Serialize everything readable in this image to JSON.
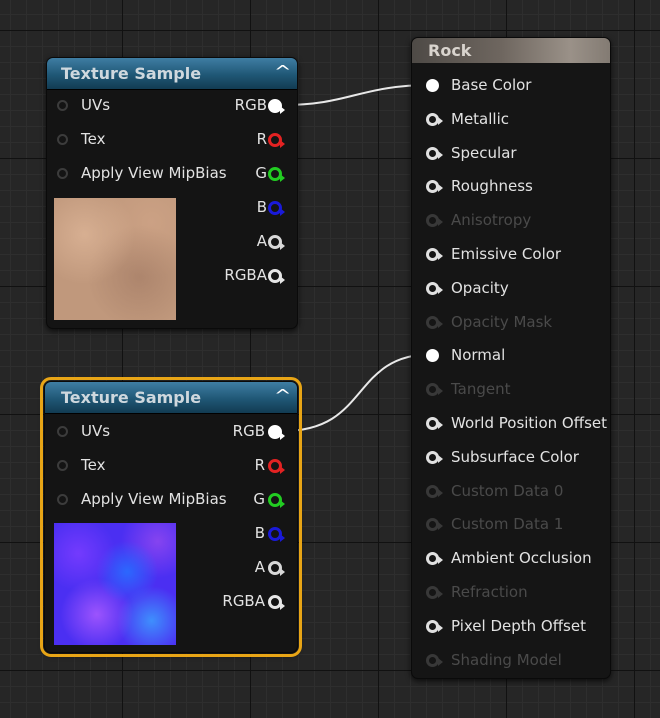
{
  "texture_nodes": [
    {
      "title": "Texture Sample",
      "inputs": [
        "UVs",
        "Tex",
        "Apply View MipBias"
      ],
      "outputs": [
        {
          "label": "RGB",
          "color": "#ffffff"
        },
        {
          "label": "R",
          "color": "#e32222"
        },
        {
          "label": "G",
          "color": "#22cc22"
        },
        {
          "label": "B",
          "color": "#1a1ad9"
        },
        {
          "label": "A",
          "color": "#d8d8d8"
        },
        {
          "label": "RGBA",
          "color": "#e6e6e6"
        }
      ],
      "thumbnail": "diffuse-rock-texture",
      "selected": false
    },
    {
      "title": "Texture Sample",
      "inputs": [
        "UVs",
        "Tex",
        "Apply View MipBias"
      ],
      "outputs": [
        {
          "label": "RGB",
          "color": "#ffffff"
        },
        {
          "label": "R",
          "color": "#e32222"
        },
        {
          "label": "G",
          "color": "#22cc22"
        },
        {
          "label": "B",
          "color": "#1a1ad9"
        },
        {
          "label": "A",
          "color": "#d8d8d8"
        },
        {
          "label": "RGBA",
          "color": "#e6e6e6"
        }
      ],
      "thumbnail": "normal-map-texture",
      "selected": true
    }
  ],
  "material_node": {
    "title": "Rock",
    "inputs": [
      {
        "label": "Base Color",
        "enabled": true,
        "connected": true
      },
      {
        "label": "Metallic",
        "enabled": true,
        "connected": false
      },
      {
        "label": "Specular",
        "enabled": true,
        "connected": false
      },
      {
        "label": "Roughness",
        "enabled": true,
        "connected": false
      },
      {
        "label": "Anisotropy",
        "enabled": false,
        "connected": false
      },
      {
        "label": "Emissive Color",
        "enabled": true,
        "connected": false
      },
      {
        "label": "Opacity",
        "enabled": true,
        "connected": false
      },
      {
        "label": "Opacity Mask",
        "enabled": false,
        "connected": false
      },
      {
        "label": "Normal",
        "enabled": true,
        "connected": true
      },
      {
        "label": "Tangent",
        "enabled": false,
        "connected": false
      },
      {
        "label": "World Position Offset",
        "enabled": true,
        "connected": false
      },
      {
        "label": "Subsurface Color",
        "enabled": true,
        "connected": false
      },
      {
        "label": "Custom Data 0",
        "enabled": false,
        "connected": false
      },
      {
        "label": "Custom Data 1",
        "enabled": false,
        "connected": false
      },
      {
        "label": "Ambient Occlusion",
        "enabled": true,
        "connected": false
      },
      {
        "label": "Refraction",
        "enabled": false,
        "connected": false
      },
      {
        "label": "Pixel Depth Offset",
        "enabled": true,
        "connected": false
      },
      {
        "label": "Shading Model",
        "enabled": false,
        "connected": false
      }
    ]
  },
  "connections": [
    {
      "from": "texture-node-1.RGB",
      "to": "material.Base Color"
    },
    {
      "from": "texture-node-2.RGB",
      "to": "material.Normal"
    }
  ],
  "colors": {
    "selection": "#e8a516",
    "header": "#1f5775",
    "wire": "#ffffff"
  }
}
